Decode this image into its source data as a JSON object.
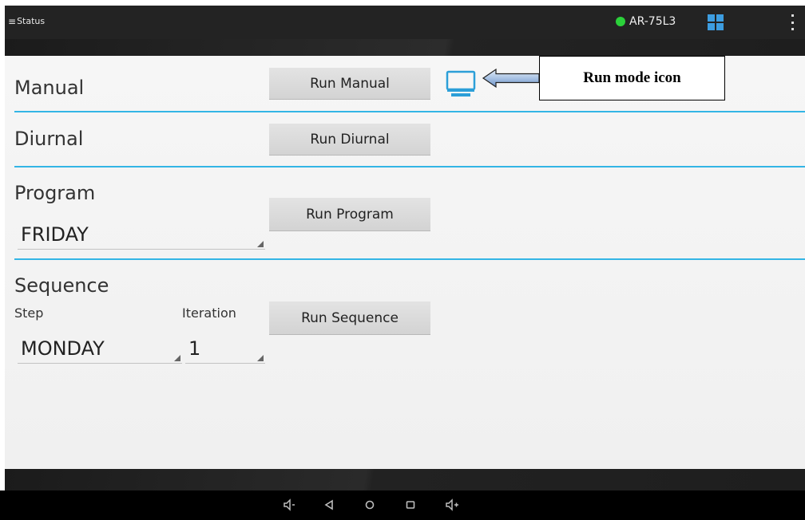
{
  "topbar": {
    "menu_label": "Status",
    "device_name": "AR-75L3",
    "status_color": "#2bd13a",
    "accent_color": "#33b5e5"
  },
  "sections": {
    "manual": {
      "title": "Manual",
      "button": "Run Manual"
    },
    "diurnal": {
      "title": "Diurnal",
      "button": "Run Diurnal"
    },
    "program": {
      "title": "Program",
      "button": "Run Program",
      "selected": "FRIDAY"
    },
    "sequence": {
      "title": "Sequence",
      "button": "Run Sequence",
      "step_label": "Step",
      "step_value": "MONDAY",
      "iteration_label": "Iteration",
      "iteration_value": "1"
    }
  },
  "annotation": {
    "label": "Run mode icon"
  },
  "icons": {
    "menu": "hamburger-menu-icon",
    "status": "connection-status-dot",
    "grid": "grid-icon",
    "overflow": "overflow-menu-icon",
    "run_mode": "monitor-icon",
    "volume_down": "volume-down-icon",
    "back": "back-icon",
    "home": "home-icon",
    "recents": "recents-icon",
    "volume_up": "volume-up-icon"
  }
}
